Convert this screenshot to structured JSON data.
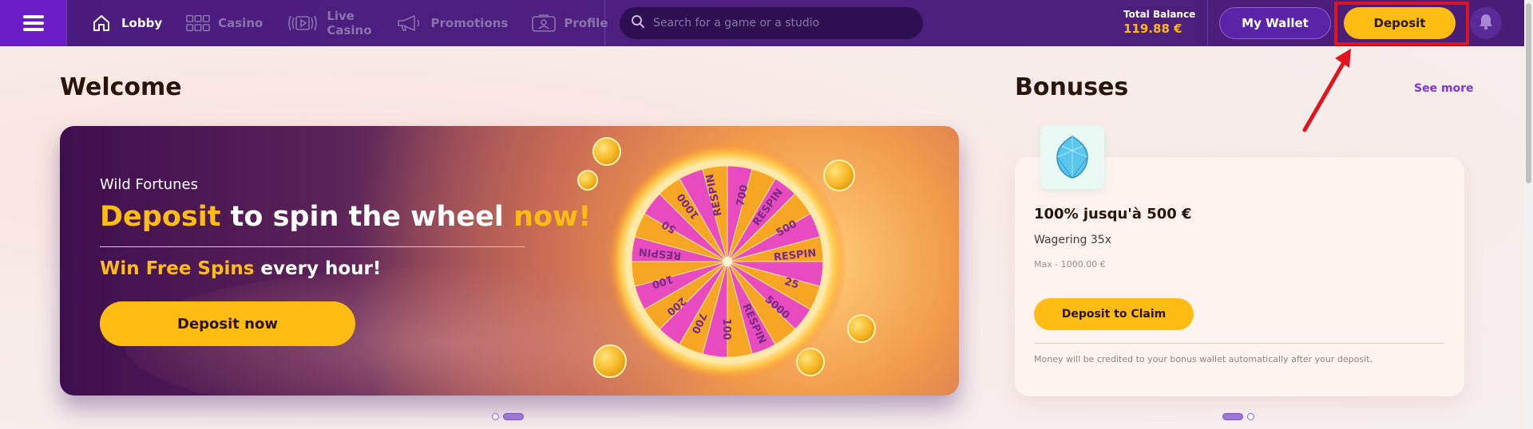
{
  "header": {
    "nav": [
      {
        "label": "Lobby",
        "icon": "home-icon",
        "active": true
      },
      {
        "label": "Casino",
        "icon": "grid-icon",
        "active": false
      },
      {
        "label": "Live Casino",
        "icon": "live-play-icon",
        "active": false
      },
      {
        "label": "Promotions",
        "icon": "megaphone-icon",
        "active": false
      },
      {
        "label": "Profile",
        "icon": "profile-card-icon",
        "active": false
      }
    ],
    "search_placeholder": "Search for a game or a studio",
    "balance_label": "Total Balance",
    "balance_value": "119.88 €",
    "wallet_label": "My Wallet",
    "deposit_label": "Deposit"
  },
  "welcome": {
    "title": "Welcome",
    "brand": "Wild Fortunes",
    "headline_1": "Deposit",
    "headline_2": " to spin the wheel ",
    "headline_3": "now!",
    "sub_1": "Win Free Spins",
    "sub_2": " every hour!",
    "cta": "Deposit now",
    "wheel_labels": [
      "700",
      "RESPIN",
      "500",
      "RESPIN",
      "25",
      "5000",
      "RESPIN",
      "100",
      "700",
      "200",
      "100",
      "RESPIN",
      "50",
      "1000",
      "RESPIN"
    ]
  },
  "bonuses": {
    "title": "Bonuses",
    "see_more": "See more",
    "card": {
      "title": "100% jusqu'à 500 €",
      "wagering": "Wagering 35x",
      "max": "Max - 1000.00 €",
      "claim": "Deposit to Claim",
      "note": "Money will be credited to your bonus wallet automatically after your deposit."
    }
  },
  "colors": {
    "brand_purple": "#4b1c7e",
    "menu_purple": "#6a1dc4",
    "accent_yellow": "#ffbc12",
    "highlight_red": "#e0141f",
    "link_purple": "#7b36d9"
  }
}
